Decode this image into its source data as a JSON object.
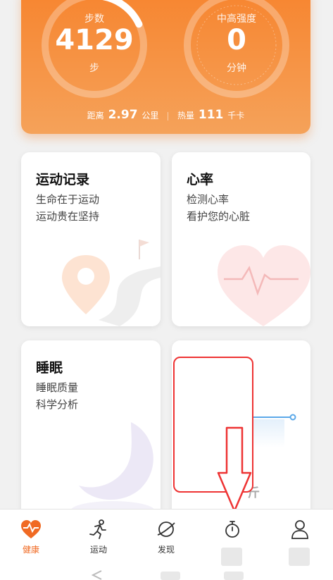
{
  "summary": {
    "steps_label": "步数",
    "steps_value": "4129",
    "steps_unit": "步",
    "intense_label": "中高强度",
    "intense_value": "0",
    "intense_unit": "分钟",
    "distance_label": "距离",
    "distance_value": "2.97",
    "distance_unit": "公里",
    "calorie_label": "热量",
    "calorie_value": "111",
    "calorie_unit": "千卡",
    "steps_progress": 0.18
  },
  "cards": {
    "exercise": {
      "title": "运动记录",
      "line1": "生命在于运动",
      "line2": "运动贵在坚持"
    },
    "heart": {
      "title": "心率",
      "line1": "检测心率",
      "line2": "看护您的心脏"
    },
    "sleep": {
      "title": "睡眠",
      "line1": "睡眠质量",
      "line2": "科学分析"
    },
    "weight": {
      "peek": "斤"
    }
  },
  "tabs": [
    {
      "label": "健康",
      "icon": "heart-pulse-icon",
      "active": true
    },
    {
      "label": "运动",
      "icon": "running-icon",
      "active": false
    },
    {
      "label": "发现",
      "icon": "planet-icon",
      "active": false
    },
    {
      "label": "",
      "icon": "stopwatch-icon",
      "active": false
    },
    {
      "label": "",
      "icon": "person-icon",
      "active": false
    }
  ],
  "colors": {
    "accent": "#f06a23",
    "annotation": "#e33333"
  }
}
